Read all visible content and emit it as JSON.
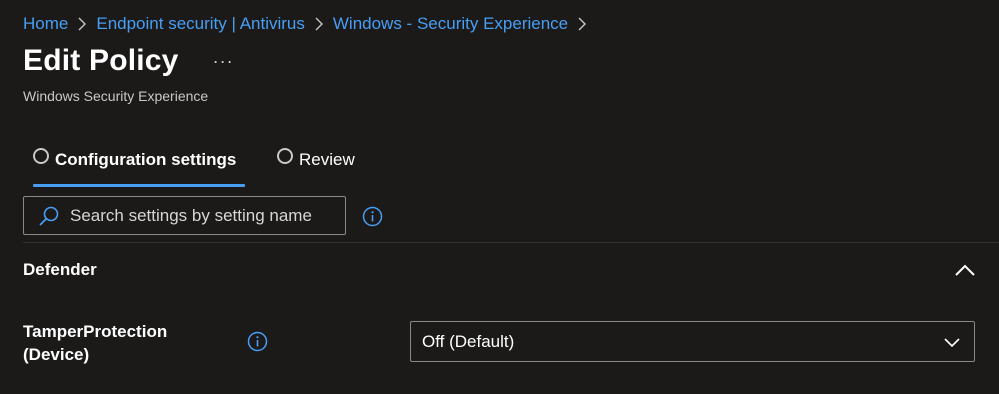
{
  "breadcrumb": {
    "items": [
      {
        "label": "Home"
      },
      {
        "label": "Endpoint security | Antivirus"
      },
      {
        "label": "Windows - Security Experience"
      }
    ]
  },
  "header": {
    "title": "Edit Policy",
    "more_label": "···",
    "subtitle": "Windows Security Experience"
  },
  "tabs": [
    {
      "label": "Configuration settings",
      "active": true
    },
    {
      "label": "Review",
      "active": false
    }
  ],
  "search": {
    "placeholder": "Search settings by setting name",
    "value": ""
  },
  "section": {
    "title": "Defender",
    "expanded": true
  },
  "settings": [
    {
      "label_line1": "TamperProtection",
      "label_line2": "(Device)",
      "value": "Off (Default)"
    }
  ],
  "colors": {
    "background": "#1b1a19",
    "accent": "#479ef5",
    "border": "#8a8886"
  },
  "icons": {
    "breadcrumb_separator": "chevron-right-icon",
    "search": "search-icon",
    "info": "info-icon",
    "collapse": "chevron-up-icon",
    "dropdown": "chevron-down-icon"
  }
}
